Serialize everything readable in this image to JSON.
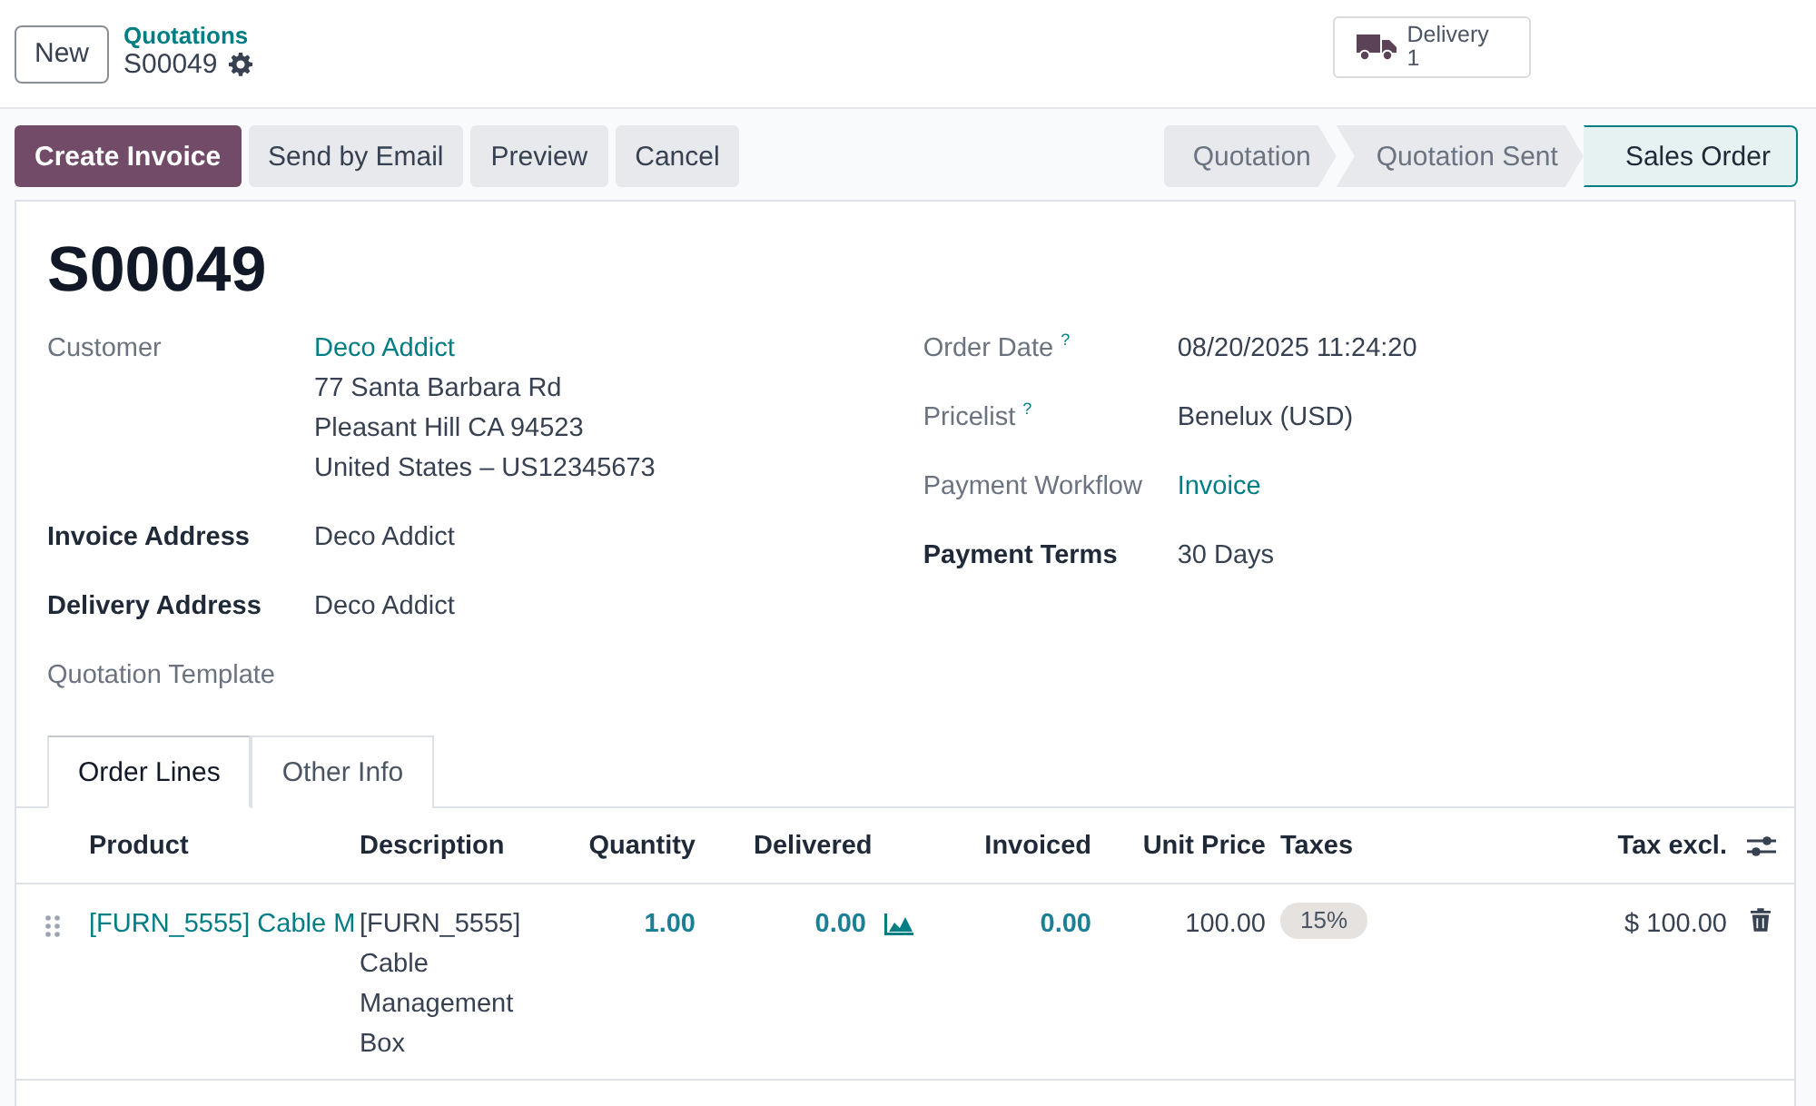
{
  "new_button": "New",
  "breadcrumb": {
    "parent": "Quotations",
    "current": "S00049"
  },
  "smart_button": {
    "label": "Delivery",
    "count": "1"
  },
  "actions": [
    {
      "label": "Create Invoice",
      "primary": true
    },
    {
      "label": "Send by Email",
      "primary": false
    },
    {
      "label": "Preview",
      "primary": false
    },
    {
      "label": "Cancel",
      "primary": false
    }
  ],
  "stages": [
    {
      "label": "Quotation",
      "selected": false
    },
    {
      "label": "Quotation Sent",
      "selected": false
    },
    {
      "label": "Sales Order",
      "selected": true
    }
  ],
  "title": "S00049",
  "left_fields": [
    {
      "label": "Customer",
      "bold": false,
      "lines": [
        {
          "text": "Deco Addict",
          "link": true
        },
        {
          "text": "77 Santa Barbara Rd",
          "link": false
        },
        {
          "text": "Pleasant Hill CA 94523",
          "link": false
        },
        {
          "text": "United States – US12345673",
          "link": false
        }
      ]
    },
    {
      "label": "Invoice Address",
      "bold": true,
      "lines": [
        {
          "text": "Deco Addict",
          "link": false
        }
      ]
    },
    {
      "label": "Delivery Address",
      "bold": true,
      "lines": [
        {
          "text": "Deco Addict",
          "link": false
        }
      ]
    },
    {
      "label": "Quotation Template",
      "bold": false
    }
  ],
  "right_fields": [
    {
      "label": "Order Date",
      "help": "?",
      "bold": false,
      "lines": [
        {
          "text": "08/20/2025 11:24:20",
          "link": false
        }
      ]
    },
    {
      "label": "Pricelist",
      "help": "?",
      "bold": false,
      "lines": [
        {
          "text": "Benelux (USD)",
          "link": false
        }
      ]
    },
    {
      "label": "Payment Workflow",
      "bold": false,
      "lines": [
        {
          "text": "Invoice",
          "link": true
        }
      ]
    },
    {
      "label": "Payment Terms",
      "bold": true,
      "lines": [
        {
          "text": "30 Days",
          "link": false
        }
      ]
    }
  ],
  "tabs": [
    {
      "label": "Order Lines",
      "selected": true
    },
    {
      "label": "Other Info",
      "selected": false
    }
  ],
  "columns": {
    "product": "Product",
    "description": "Description",
    "quantity": "Quantity",
    "delivered": "Delivered",
    "invoiced": "Invoiced",
    "unit_price": "Unit Price",
    "taxes": "Taxes",
    "subtotal": "Tax excl."
  },
  "rows": [
    {
      "product": "[FURN_5555] Cable M",
      "description": "[FURN_5555] Cable Management Box",
      "quantity": "1.00",
      "delivered": "0.00",
      "invoiced": "0.00",
      "unit_price": "100.00",
      "taxes": [
        "15%"
      ],
      "subtotal": "$ 100.00"
    }
  ]
}
